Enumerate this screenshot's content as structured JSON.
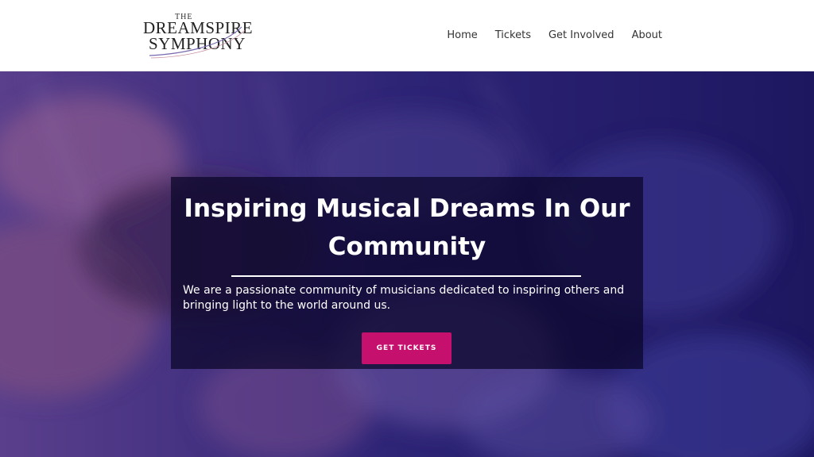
{
  "brand": {
    "logo_the": "THE",
    "logo_line1": "DREAMSPIRE",
    "logo_line2": "SYMPHONY"
  },
  "nav": {
    "items": [
      "Home",
      "Tickets",
      "Get Involved",
      "About"
    ]
  },
  "hero": {
    "title": "Inspiring Musical Dreams In Our Community",
    "text": "We are a passionate community of musicians dedicated to inspiring others and bringing light to the world around us.",
    "cta_label": "GET TICKETS"
  },
  "colors": {
    "accent": "#c5106e",
    "hero_tint": "#2a1d69",
    "overlay": "#0a0628"
  }
}
